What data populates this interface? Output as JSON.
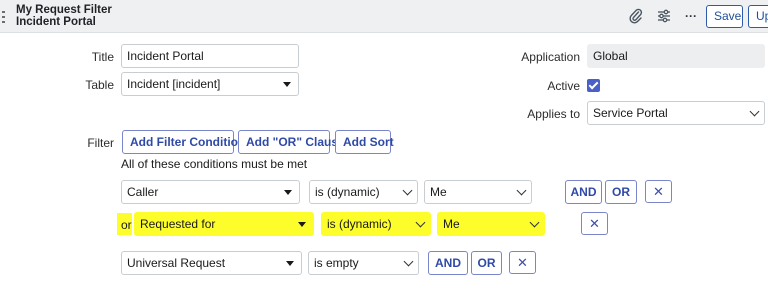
{
  "header": {
    "title_line1": "My Request Filter",
    "title_line2": "Incident Portal",
    "save_label": "Save",
    "update_label": "Up",
    "more_label": "···"
  },
  "form": {
    "title_label": "Title",
    "title_value": "Incident Portal",
    "table_label": "Table",
    "table_value": "Incident [incident]",
    "application_label": "Application",
    "application_value": "Global",
    "active_label": "Active",
    "active_checked": true,
    "applies_to_label": "Applies to",
    "applies_to_value": "Service Portal",
    "filter_label": "Filter"
  },
  "filter": {
    "add_condition_label": "Add Filter Condition",
    "add_or_label": "Add \"OR\" Clause",
    "add_sort_label": "Add Sort",
    "summary": "All of these conditions must be met",
    "or_prefix": "or",
    "and_label": "AND",
    "or_label": "OR",
    "remove_label": "✕",
    "conditions": [
      {
        "field": "Caller",
        "operator": "is (dynamic)",
        "value": "Me"
      },
      {
        "field": "Requested for",
        "operator": "is (dynamic)",
        "value": "Me"
      },
      {
        "field": "Universal Request",
        "operator": "is empty",
        "value": ""
      }
    ]
  },
  "colors": {
    "highlight": "#fdfd2b",
    "accent": "#4a5fc7",
    "header_bg": "#eef0f1"
  }
}
